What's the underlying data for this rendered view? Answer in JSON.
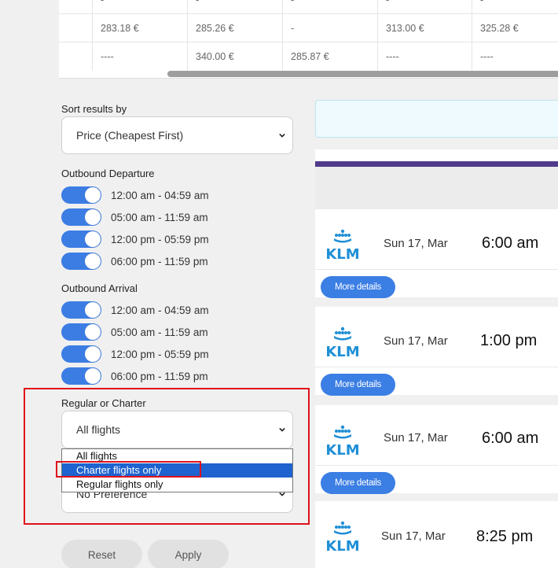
{
  "price_table": {
    "rows": [
      [
        "-",
        "-",
        "-",
        "-",
        "-"
      ],
      [
        "283.18 €",
        "285.26 €",
        "-",
        "313.00 €",
        "325.28 €"
      ],
      [
        "----",
        "340.00 €",
        "285.87 €",
        "----",
        "----"
      ]
    ]
  },
  "filters": {
    "sort": {
      "label": "Sort results by",
      "value": "Price (Cheapest First)"
    },
    "outbound_departure": {
      "label": "Outbound Departure",
      "options": [
        "12:00 am - 04:59 am",
        "05:00 am - 11:59 am",
        "12:00 pm - 05:59 pm",
        "06:00 pm - 11:59 pm"
      ]
    },
    "outbound_arrival": {
      "label": "Outbound Arrival",
      "options": [
        "12:00 am - 04:59 am",
        "05:00 am - 11:59 am",
        "12:00 pm - 05:59 pm",
        "06:00 pm - 11:59 pm"
      ]
    },
    "regular_charter": {
      "label": "Regular or Charter",
      "value": "All flights",
      "options": [
        "All flights",
        "Charter flights only",
        "Regular flights only"
      ],
      "highlighted": "Charter flights only"
    },
    "hidden_select_value": "No Preference",
    "reset_label": "Reset",
    "apply_label": "Apply"
  },
  "results": [
    {
      "airline": "KLM",
      "date": "Sun 17, Mar",
      "time": "6:00 am",
      "details": "More details"
    },
    {
      "airline": "KLM",
      "date": "Sun 17, Mar",
      "time": "1:00 pm",
      "details": "More details"
    },
    {
      "airline": "KLM",
      "date": "Sun 17, Mar",
      "time": "6:00 am",
      "details": "More details"
    },
    {
      "airline": "KLM",
      "date": "Sun 17, Mar",
      "time": "8:25 pm"
    }
  ],
  "colors": {
    "accent": "#3c7de4",
    "highlight_red": "#e0101a",
    "klm_blue": "#1f8fd6",
    "header_bar": "#4f3b8a"
  }
}
